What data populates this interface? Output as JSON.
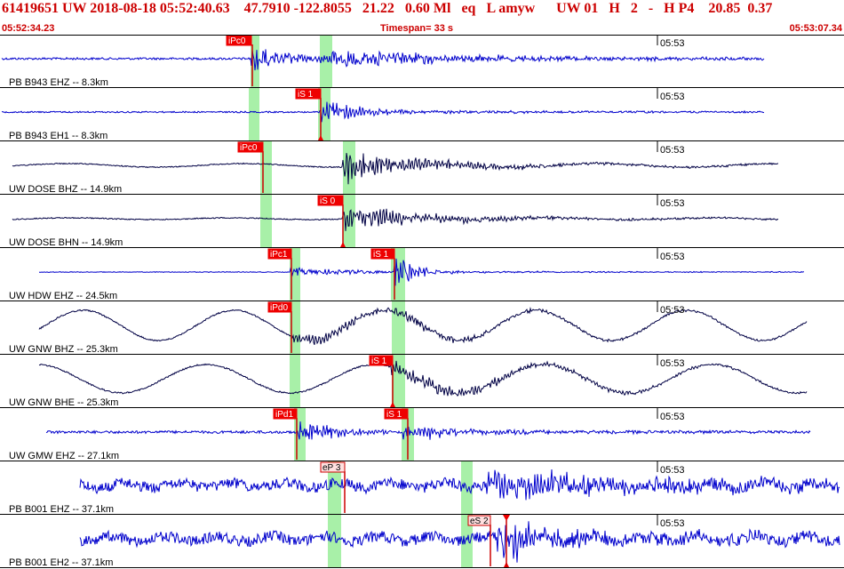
{
  "header": {
    "event_line": "61419651 UW 2018-08-18 05:52:40.63    47.7910 -122.8055   21.22   0.60 Ml   eq   L amyw      UW 01   H   2   -   H P4    20.85  0.37",
    "start_time": "05:52:34.23",
    "timespan": "Timespan=  33 s",
    "end_time": "05:53:07.34"
  },
  "chart_data": {
    "type": "seismogram",
    "minute_tick_label": "05:53",
    "colors": {
      "trace_blue": "#0000cc",
      "trace_navy": "#000044",
      "pick_box": "#ee0000",
      "pick_line": "#cc0000",
      "window": "#a8f0a8",
      "hollow_pick_box": "#ffe0e0"
    },
    "traces": [
      {
        "label": "PB B943 EHZ -- 8.3km",
        "color": "blue",
        "picks": [
          {
            "text": "iPc0"
          }
        ]
      },
      {
        "label": "PB B943 EH1 -- 8.3km",
        "color": "blue",
        "picks": [
          {
            "text": "iS 1"
          }
        ]
      },
      {
        "label": "UW DOSE BHZ -- 14.9km",
        "color": "navy",
        "picks": [
          {
            "text": "iPc0"
          }
        ]
      },
      {
        "label": "UW DOSE BHN -- 14.9km",
        "color": "navy",
        "picks": [
          {
            "text": "iS 0"
          }
        ]
      },
      {
        "label": "UW HDW EHZ -- 24.5km",
        "color": "blue",
        "picks": [
          {
            "text": "iPc1"
          },
          {
            "text": "iS 1"
          }
        ]
      },
      {
        "label": "UW GNW BHZ -- 25.3km",
        "color": "navy",
        "picks": [
          {
            "text": "iPd0"
          }
        ]
      },
      {
        "label": "UW GNW BHE -- 25.3km",
        "color": "navy",
        "picks": [
          {
            "text": "iS 1"
          }
        ]
      },
      {
        "label": "UW GMW EHZ -- 27.1km",
        "color": "blue",
        "picks": [
          {
            "text": "iPd1"
          },
          {
            "text": "iS 1"
          }
        ]
      },
      {
        "label": "PB B001 EHZ -- 37.1km",
        "color": "blue",
        "picks": [
          {
            "text": "eP 3"
          }
        ]
      },
      {
        "label": "PB B001 EH2 -- 37.1km",
        "color": "blue",
        "picks": [
          {
            "text": "eS 2"
          }
        ]
      }
    ]
  }
}
